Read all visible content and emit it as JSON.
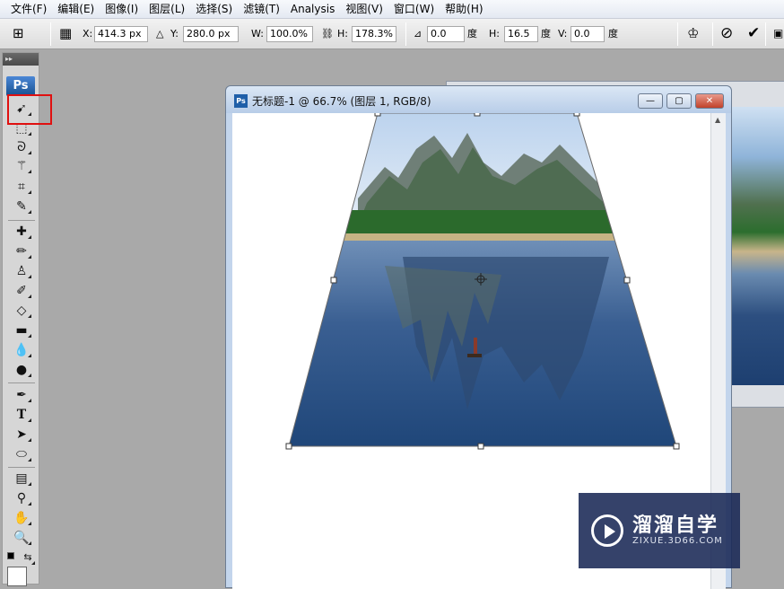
{
  "menu": [
    "文件(F)",
    "编辑(E)",
    "图像(I)",
    "图层(L)",
    "选择(S)",
    "滤镜(T)",
    "Analysis",
    "视图(V)",
    "窗口(W)",
    "帮助(H)"
  ],
  "options": {
    "x_label": "X:",
    "x_value": "414.3 px",
    "y_label": "Y:",
    "y_value": "280.0 px",
    "w_label": "W:",
    "w_value": "100.0%",
    "h_label": "H:",
    "h_value": "178.3%",
    "rot_value": "0.0",
    "rot_unit": "度",
    "hskew_label": "H:",
    "hskew_value": "16.5",
    "hskew_unit": "度",
    "vskew_label": "V:",
    "vskew_value": "0.0",
    "vskew_unit": "度"
  },
  "tools": {
    "logo": "Ps",
    "items": [
      "move-icon",
      "marquee-icon",
      "lasso-icon",
      "magic-wand-icon",
      "crop-icon",
      "slice-icon",
      "healing-brush-icon",
      "brush-icon",
      "clone-stamp-icon",
      "history-brush-icon",
      "eraser-icon",
      "gradient-icon",
      "blur-icon",
      "dodge-icon",
      "pen-icon",
      "type-icon",
      "path-select-icon",
      "ellipse-icon",
      "notes-icon",
      "eyedropper-icon",
      "hand-icon",
      "zoom-icon"
    ]
  },
  "document": {
    "title": "无标题-1 @ 66.7% (图层 1, RGB/8)",
    "min_label": "—",
    "max_label": "▢",
    "close_label": "✕"
  },
  "watermark": {
    "brand": "溜溜自学",
    "url": "ZIXUE.3D66.COM"
  },
  "colors": {
    "highlight_box": "#e01010",
    "watermark_bg": "#192855"
  }
}
